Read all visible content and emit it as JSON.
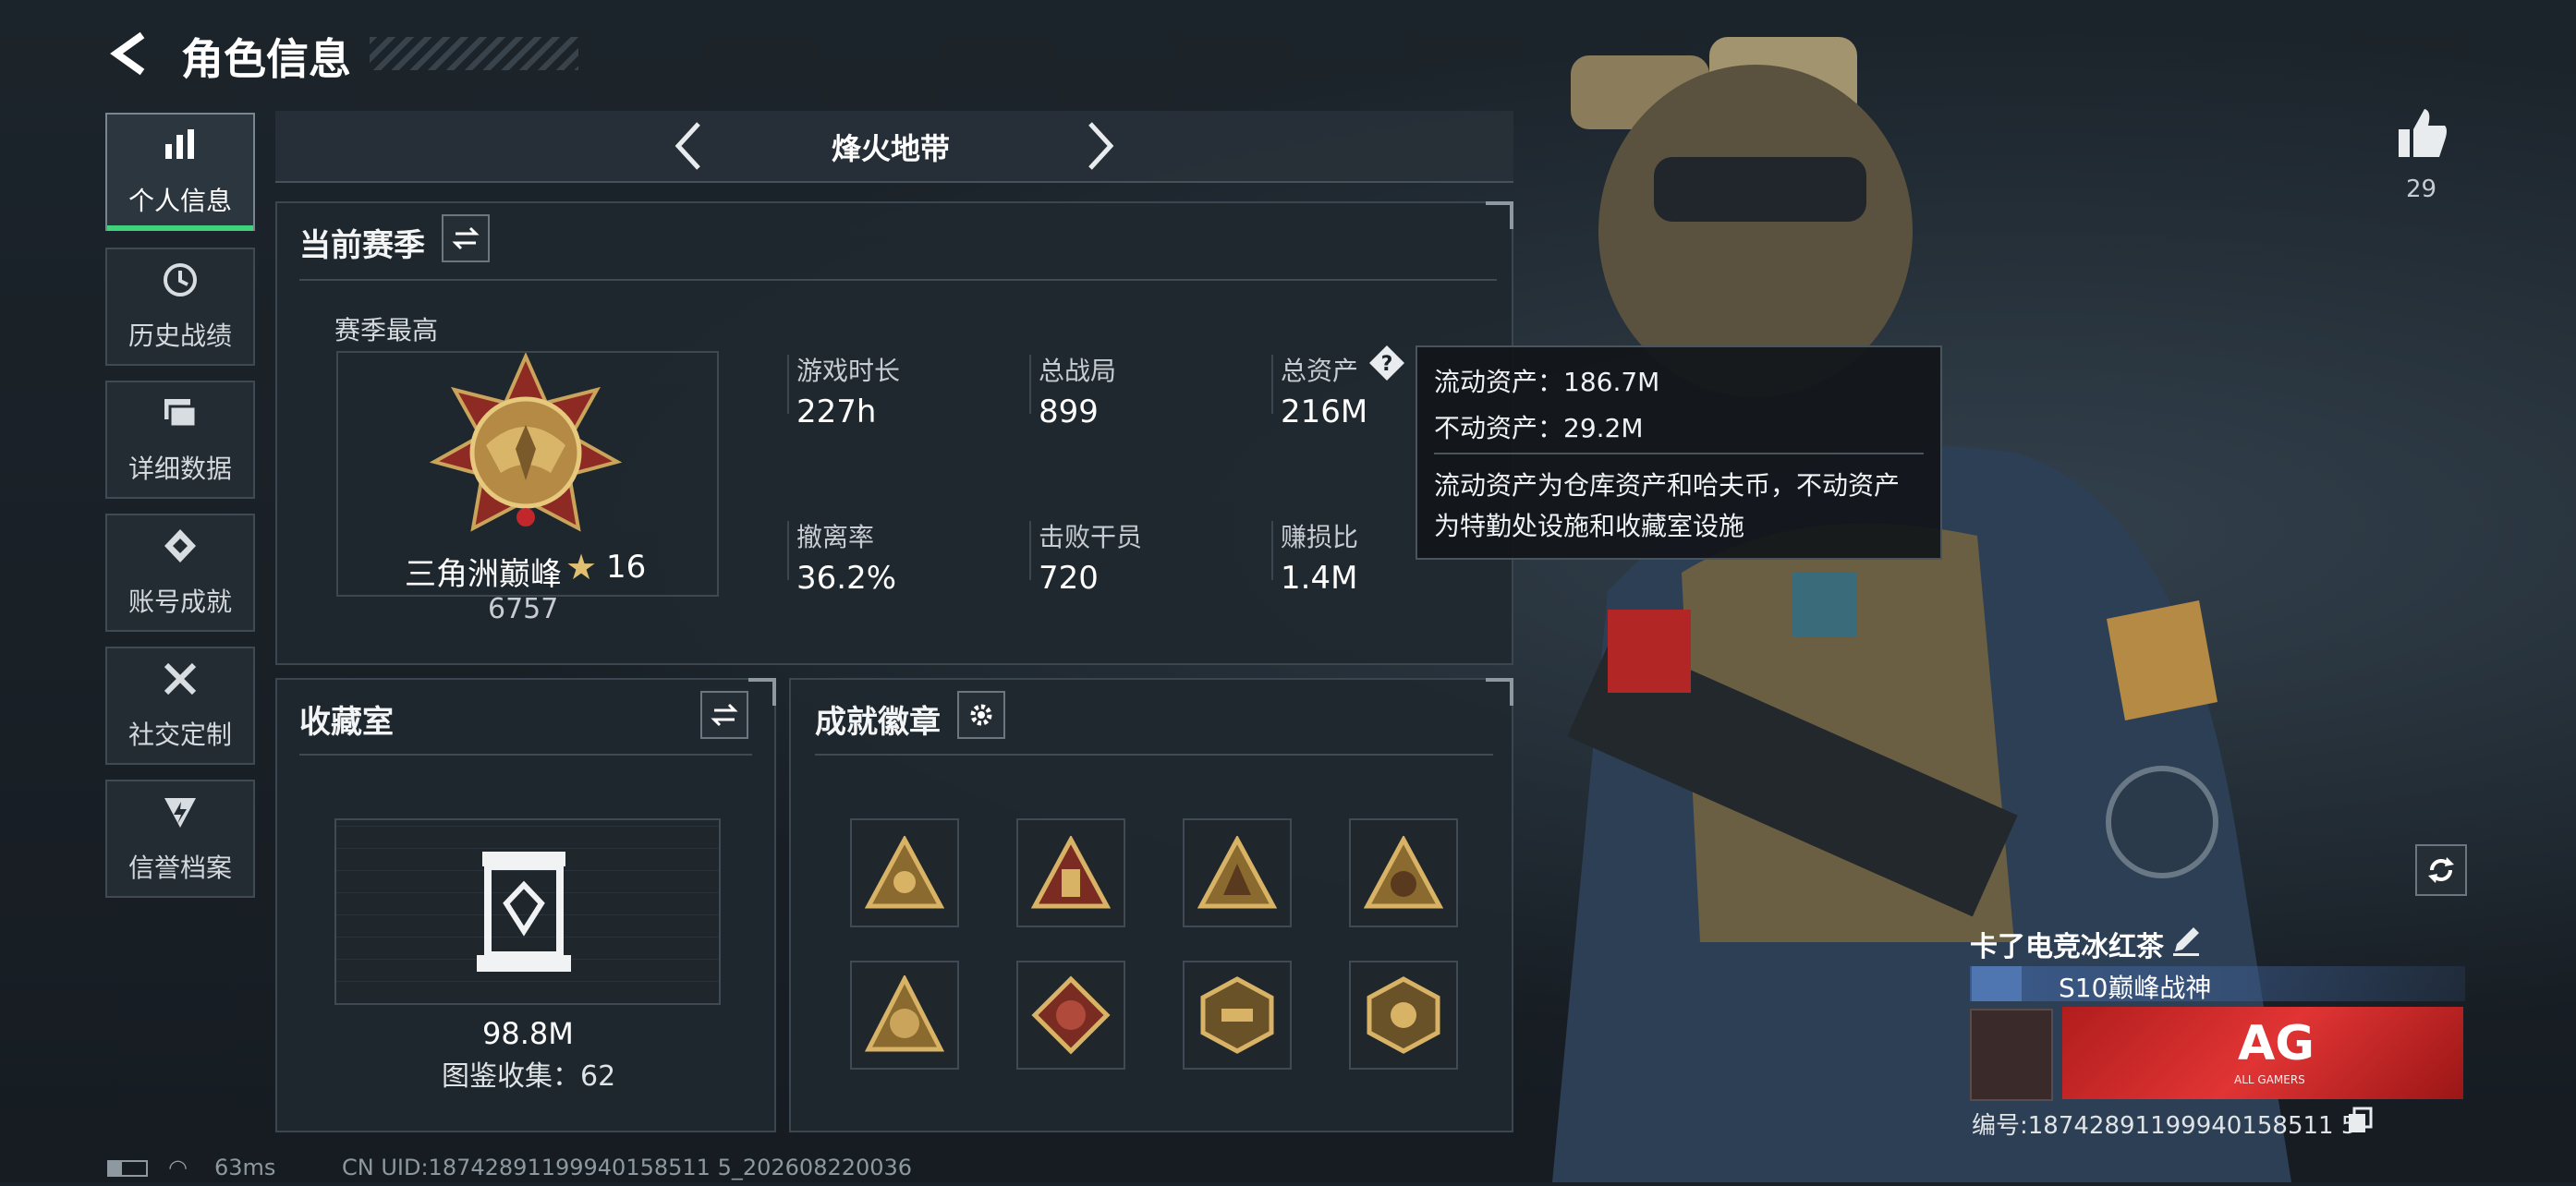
{
  "header": {
    "title": "角色信息"
  },
  "sidebar": {
    "items": [
      {
        "label": "个人信息",
        "icon": "bar-chart-icon"
      },
      {
        "label": "历史战绩",
        "icon": "clock-icon"
      },
      {
        "label": "详细数据",
        "icon": "folders-icon"
      },
      {
        "label": "账号成就",
        "icon": "achievement-icon"
      },
      {
        "label": "社交定制",
        "icon": "tools-icon"
      },
      {
        "label": "信誉档案",
        "icon": "credit-icon"
      }
    ]
  },
  "mode_selector": {
    "label": "烽火地带"
  },
  "season": {
    "title": "当前赛季",
    "best_label": "赛季最高",
    "rank_name": "三角洲巅峰",
    "rank_stars": "16",
    "rank_score": "6757",
    "stats": [
      {
        "label": "游戏时长",
        "value": "227h"
      },
      {
        "label": "总战局",
        "value": "899"
      },
      {
        "label": "总资产",
        "value": "216M"
      },
      {
        "label": "撤离率",
        "value": "36.2%"
      },
      {
        "label": "击败干员",
        "value": "720"
      },
      {
        "label": "赚损比",
        "value": "1.4M"
      }
    ]
  },
  "tooltip": {
    "liquid": "流动资产：186.7M",
    "fixed": "不动资产：29.2M",
    "desc_line1": "流动资产为仓库资产和哈夫币，不动资产",
    "desc_line2": "为特勤处设施和收藏室设施"
  },
  "collection": {
    "title": "收藏室",
    "value": "98.8M",
    "count_text": "图鉴收集：62"
  },
  "achievements": {
    "title": "成就徽章",
    "badges": [
      "badge-1",
      "badge-2",
      "badge-3",
      "badge-4",
      "badge-5",
      "badge-6",
      "badge-7",
      "badge-8"
    ]
  },
  "likes": {
    "count": "29"
  },
  "player": {
    "name": "卡了电竞冰红茶",
    "title": "S10巅峰战神",
    "banner_text": "AG",
    "banner_sub": "ALL GAMERS",
    "id_text": "编号:18742891199940158511 5"
  },
  "status_bar": {
    "ping": "63ms",
    "uid": "CN UID:18742891199940158511 5_202608220036"
  },
  "colors": {
    "accent_green": "#3fd37c",
    "gold": "#c9a45a",
    "banner_red": "#d42b2b"
  }
}
